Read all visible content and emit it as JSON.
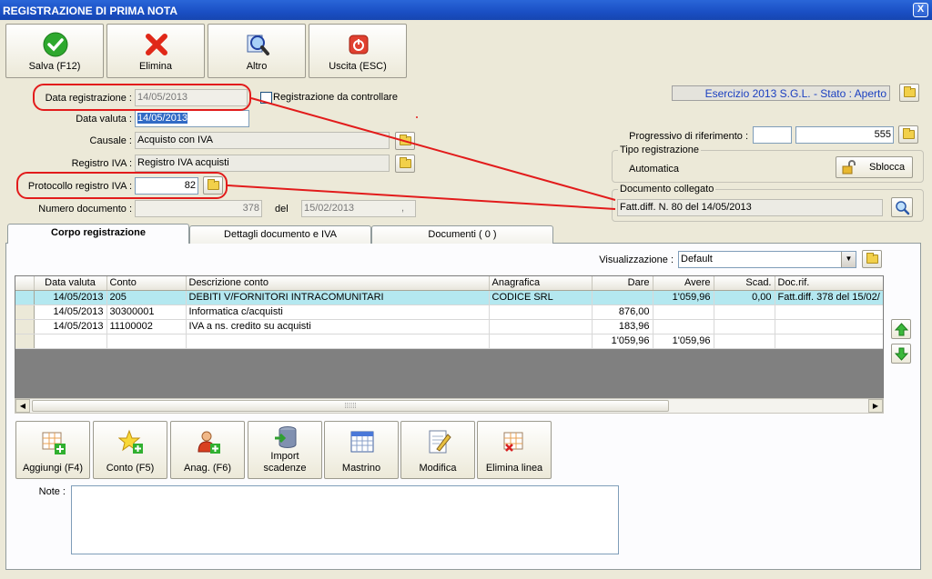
{
  "window": {
    "title": "REGISTRAZIONE DI PRIMA NOTA",
    "close_glyph": "X"
  },
  "toolbar": {
    "save": "Salva (F12)",
    "delete": "Elimina",
    "other": "Altro",
    "exit": "Uscita (ESC)"
  },
  "form": {
    "data_registrazione_label": "Data registrazione :",
    "data_registrazione": "14/05/2013",
    "registrazione_da_controllare": "Registrazione da controllare",
    "data_valuta_label": "Data valuta :",
    "data_valuta": "14/05/2013",
    "causale_label": "Causale :",
    "causale": "Acquisto con IVA",
    "registro_iva_label": "Registro IVA :",
    "registro_iva": "Registro IVA acquisti",
    "protocollo_label": "Protocollo registro IVA :",
    "protocollo": "82",
    "numero_documento_label": "Numero documento :",
    "numero_documento": "378",
    "del_label": "del",
    "del_date": "15/02/2013",
    "del_suffix": ","
  },
  "right_panel": {
    "esercizio": "Esercizio 2013 S.G.L. - Stato : Aperto",
    "progressivo_label": "Progressivo di riferimento :",
    "progressivo_value": "555",
    "tipo_registrazione_title": "Tipo registrazione",
    "tipo_registrazione": "Automatica",
    "sblocca": "Sblocca",
    "documento_collegato_title": "Documento collegato",
    "documento_collegato": "Fatt.diff. N. 80 del 14/05/2013"
  },
  "tabs": [
    {
      "label": "Corpo registrazione"
    },
    {
      "label": "Dettagli documento e IVA"
    },
    {
      "label": "Documenti ( 0 )"
    }
  ],
  "visualizzazione": {
    "label": "Visualizzazione :",
    "value": "Default"
  },
  "grid": {
    "columns": [
      "Data valuta",
      "Conto",
      "Descrizione conto",
      "Anagrafica",
      "Dare",
      "Avere",
      "Scad.",
      "Doc.rif."
    ],
    "rows": [
      [
        "14/05/2013",
        "205",
        "DEBITI V/FORNITORI INTRACOMUNITARI",
        "CODICE SRL",
        "",
        "1'059,96",
        "0,00",
        "Fatt.diff. 378 del 15/02/"
      ],
      [
        "14/05/2013",
        "30300001",
        "Informatica c/acquisti",
        "",
        "876,00",
        "",
        "",
        ""
      ],
      [
        "14/05/2013",
        "11100002",
        "IVA a ns. credito su acquisti",
        "",
        "183,96",
        "",
        "",
        ""
      ],
      [
        "",
        "",
        "",
        "",
        "1'059,96",
        "1'059,96",
        "",
        ""
      ]
    ]
  },
  "actions": {
    "aggiungi": "Aggiungi (F4)",
    "conto": "Conto (F5)",
    "anag": "Anag. (F6)",
    "import_l1": "Import",
    "import_l2": "scadenze",
    "mastrino": "Mastrino",
    "modifica": "Modifica",
    "elimina_linea": "Elimina linea"
  },
  "note_label": "Note :",
  "colors": {
    "title_bar": "#1a4fc4",
    "selected_row": "#b4e8f0",
    "annotation": "#e21b1b",
    "esercizio_text": "#1a3fc0"
  }
}
